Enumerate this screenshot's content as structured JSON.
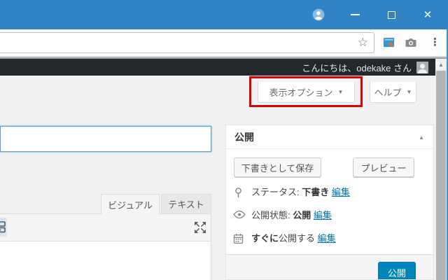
{
  "icons": {
    "close": "✕",
    "star": "☆",
    "menu_dots": "⋮",
    "scroll_up": "▲",
    "panel_collapse": "▲"
  },
  "browser": {
    "url_value": ""
  },
  "admin_bar": {
    "greeting": "こんにちは、odekake さん"
  },
  "screen_meta": {
    "screen_options": {
      "label": "表示オプション",
      "arrow": "▼"
    },
    "help": {
      "label": "ヘルプ",
      "arrow": "▼"
    }
  },
  "editor": {
    "title_field": {
      "value": "",
      "placeholder": ""
    },
    "tabs": [
      {
        "label": "ビジュアル",
        "active": true
      },
      {
        "label": "テキスト",
        "active": false
      }
    ]
  },
  "publish_panel": {
    "title": "公開",
    "save_draft_label": "下書きとして保存",
    "preview_label": "プレビュー",
    "rows": [
      {
        "icon": "pin-icon",
        "prefix": "ステータス: ",
        "value": "下書き",
        "suffix": " ",
        "link": "編集"
      },
      {
        "icon": "eye-icon",
        "prefix": "公開状態: ",
        "value": "公開",
        "suffix": " ",
        "link": "編集"
      },
      {
        "icon": "calendar-icon",
        "prefix": "",
        "value": "すぐに",
        "suffix": "公開する ",
        "link": "編集"
      }
    ],
    "publish_label": "公開"
  },
  "annotation": {
    "highlight_color": "#dd0202"
  },
  "colors": {
    "titlebar_blue": "#3084c6",
    "admin_bar_dark": "#23282d",
    "publish_button_blue": "#0085ba",
    "link_blue": "#0073aa",
    "page_bg": "#f1f1f1"
  }
}
